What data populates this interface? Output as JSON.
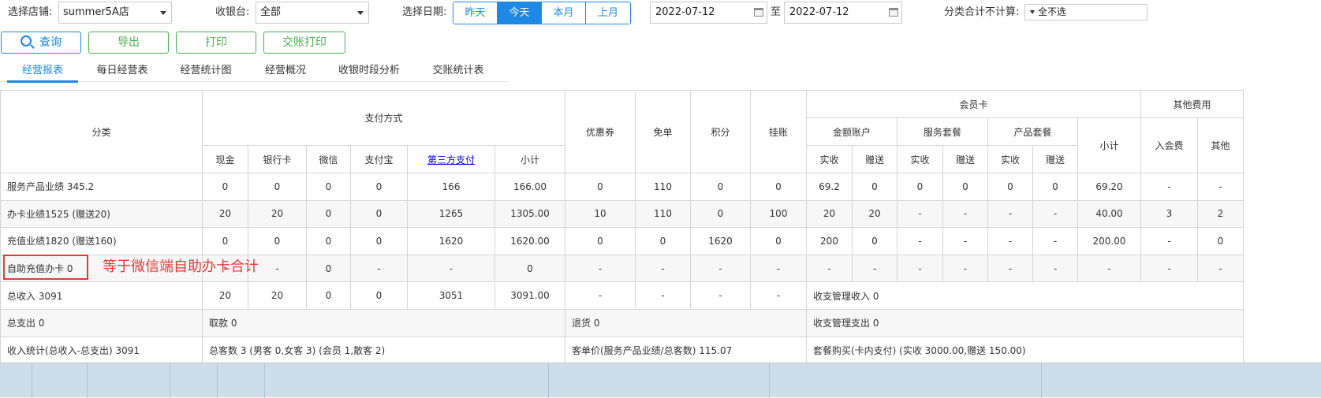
{
  "filters": {
    "store_label": "选择店铺:",
    "store_value": "summer5A店",
    "register_label": "收银台:",
    "register_value": "全部",
    "date_label": "选择日期:",
    "date_buttons": [
      "昨天",
      "今天",
      "本月",
      "上月"
    ],
    "date_active": "今天",
    "date_from": "2022-07-12",
    "date_sep": "至",
    "date_to": "2022-07-12",
    "exclude_label": "分类合计不计算:",
    "exclude_value": "全不选"
  },
  "actions": {
    "search": "查询",
    "export": "导出",
    "print": "打印",
    "shift_print": "交账打印"
  },
  "tabs": [
    "经营报表",
    "每日经营表",
    "经营统计图",
    "经营概况",
    "收银时段分析",
    "交账统计表"
  ],
  "tab_active": "经营报表",
  "headers": {
    "category": "分类",
    "payment": "支付方式",
    "pay_cols": [
      "现金",
      "银行卡",
      "微信",
      "支付宝",
      "第三方支付",
      "小计"
    ],
    "coupon": "优惠券",
    "free": "免单",
    "points": "积分",
    "credit": "挂账",
    "member_card": "会员卡",
    "amount_account": "金额账户",
    "service_pkg": "服务套餐",
    "product_pkg": "产品套餐",
    "member_subtotal": "小计",
    "sub_cols": [
      "实收",
      "赠送"
    ],
    "other_fees": "其他费用",
    "other_cols": [
      "入会费",
      "其他"
    ]
  },
  "rows": [
    {
      "category": "服务产品业绩 345.2",
      "cells": [
        "0",
        "0",
        "0",
        "0",
        "166",
        "166.00",
        "0",
        "110",
        "0",
        "0",
        "69.2",
        "0",
        "0",
        "0",
        "0",
        "0",
        "69.20",
        "-",
        "-"
      ]
    },
    {
      "category": "办卡业绩1525 (赠送20)",
      "cells": [
        "20",
        "20",
        "0",
        "0",
        "1265",
        "1305.00",
        "10",
        "110",
        "0",
        "100",
        "20",
        "20",
        "-",
        "-",
        "-",
        "-",
        "40.00",
        "3",
        "2"
      ]
    },
    {
      "category": "充值业绩1820 (赠送160)",
      "cells": [
        "0",
        "0",
        "0",
        "0",
        "1620",
        "1620.00",
        "0",
        "0",
        "1620",
        "0",
        "200",
        "0",
        "-",
        "-",
        "-",
        "-",
        "200.00",
        "-",
        "0"
      ]
    },
    {
      "category": "自助充值办卡 0",
      "cells": [
        "-",
        "-",
        "0",
        "-",
        "-",
        "0",
        "-",
        "-",
        "-",
        "-",
        "-",
        "-",
        "-",
        "-",
        "-",
        "-",
        "-",
        "-",
        "-"
      ]
    },
    {
      "category": "总收入 3091",
      "cells": [
        "20",
        "20",
        "0",
        "0",
        "3051",
        "3091.00",
        "-",
        "-",
        "-",
        "-"
      ],
      "tail": "收支管理收入 0"
    }
  ],
  "summary": [
    {
      "a": "总支出 0",
      "b": "取款 0",
      "c": "退货 0",
      "d": "收支管理支出 0"
    },
    {
      "a": "收入统计(总收入-总支出) 3091",
      "b": "总客数 3 (男客 0,女客 3) (会员 1,散客 2)",
      "c": "客单价(服务产品业绩/总客数) 115.07",
      "d": "套餐购买(卡内支付) (实收 3000.00,赠送 150.00)"
    }
  ],
  "annotation": "等于微信端自助办卡合计",
  "colors": {
    "accent_blue": "#1e88e5",
    "accent_green": "#4caf50",
    "annotation_red": "#e53935"
  }
}
